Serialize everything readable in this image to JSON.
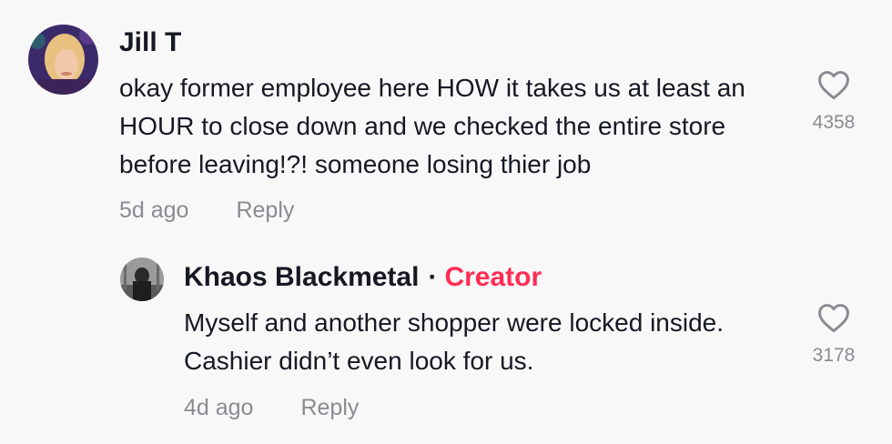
{
  "comments": [
    {
      "username": "Jill T",
      "text": "okay former employee here HOW it takes us at least an HOUR to close down and we checked the entire store before leaving!?! someone losing thier job",
      "time": "5d ago",
      "reply_label": "Reply",
      "likes": "4358",
      "icons": {
        "like": "heart-outline-icon"
      }
    },
    {
      "username": "Khaos Blackmetal",
      "creator_separator": "·",
      "badge": "Creator",
      "text": "Myself and another shopper were locked inside. Cashier didn’t even look for us.",
      "time": "4d ago",
      "reply_label": "Reply",
      "likes": "3178",
      "icons": {
        "like": "heart-outline-icon"
      }
    }
  ],
  "colors": {
    "creator": "#fe2c55",
    "meta": "#8a8b91",
    "text": "#161823"
  }
}
